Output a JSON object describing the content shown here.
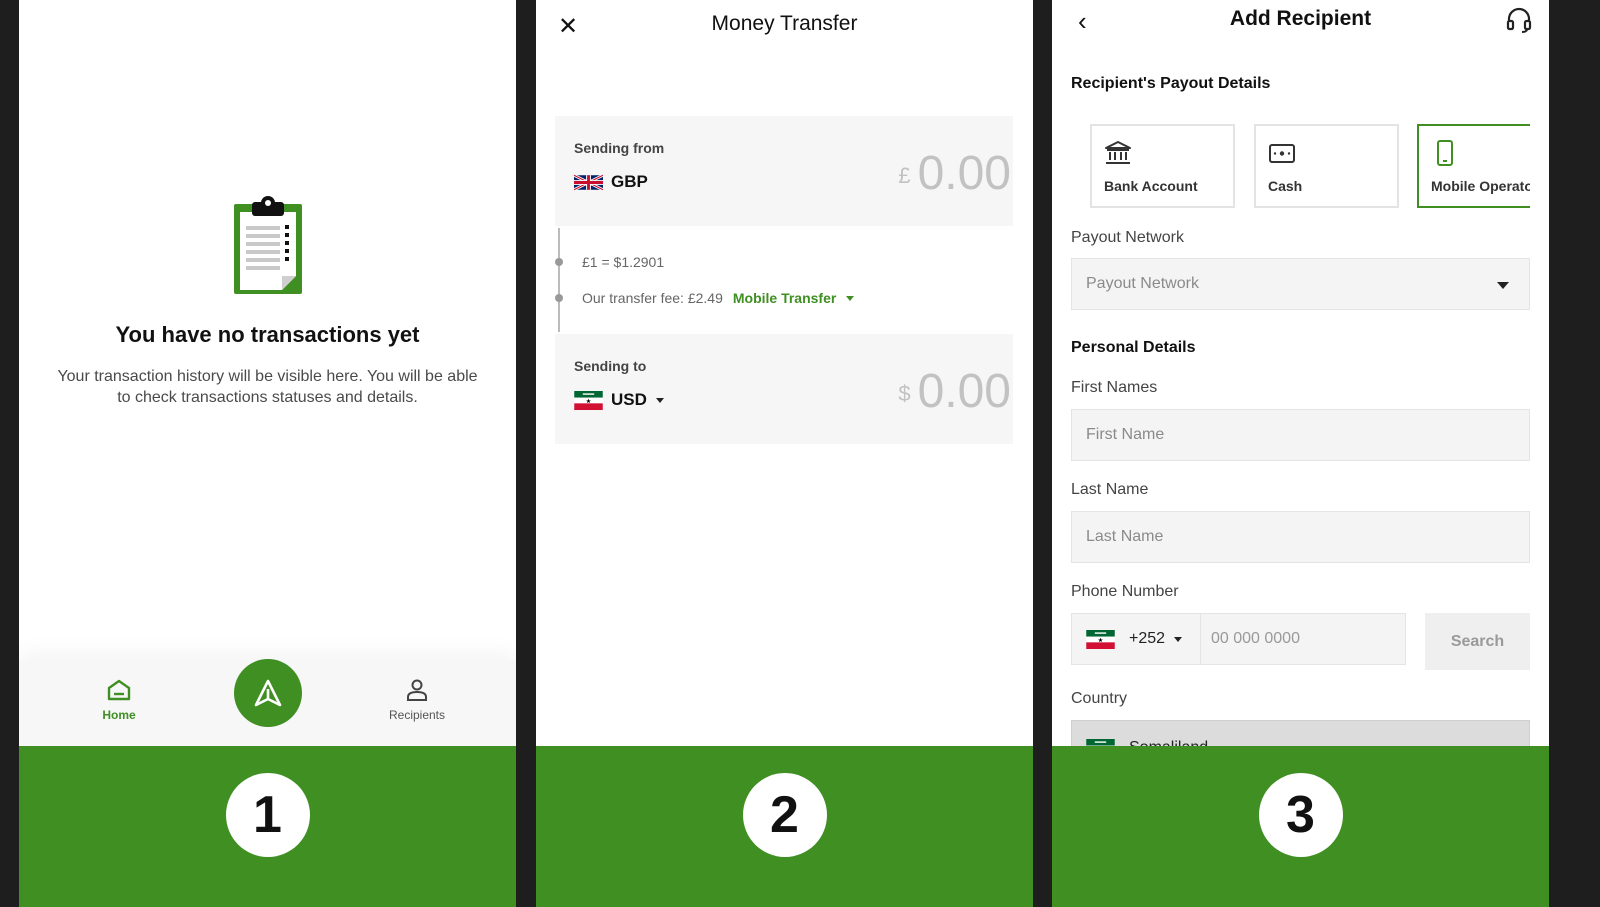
{
  "brand": {
    "primary": "#3f8f23",
    "background": "#1e1e1e"
  },
  "steps": [
    "1",
    "2",
    "3"
  ],
  "panel1": {
    "empty_title": "You have no transactions yet",
    "empty_desc": "Your transaction history will be visible here. You will be able to check transactions statuses and details.",
    "nav": {
      "home": "Home",
      "recipients": "Recipients"
    },
    "icons": [
      "clipboard-icon",
      "home-icon",
      "send-icon",
      "person-icon"
    ]
  },
  "panel2": {
    "title": "Money Transfer",
    "from": {
      "label": "Sending from",
      "currency": "GBP",
      "symbol": "£",
      "amount": "0.00"
    },
    "rate": "£1 = $1.2901",
    "fee": "Our transfer fee: £2.49",
    "method": "Mobile Transfer",
    "to": {
      "label": "Sending to",
      "currency": "USD",
      "symbol": "$",
      "amount": "0.00"
    }
  },
  "panel3": {
    "title": "Add Recipient",
    "payout_title": "Recipient's Payout Details",
    "options": [
      "Bank Account",
      "Cash",
      "Mobile Operator"
    ],
    "selected_option": "Mobile Operator",
    "payout_network": {
      "label": "Payout Network",
      "placeholder": "Payout Network"
    },
    "personal_title": "Personal Details",
    "first_names": {
      "label": "First Names",
      "placeholder": "First Name"
    },
    "last_name": {
      "label": "Last Name",
      "placeholder": "Last Name"
    },
    "phone": {
      "label": "Phone Number",
      "code": "+252",
      "placeholder": "00 000 0000",
      "search": "Search"
    },
    "country": {
      "label": "Country",
      "value": "Somaliland"
    }
  }
}
